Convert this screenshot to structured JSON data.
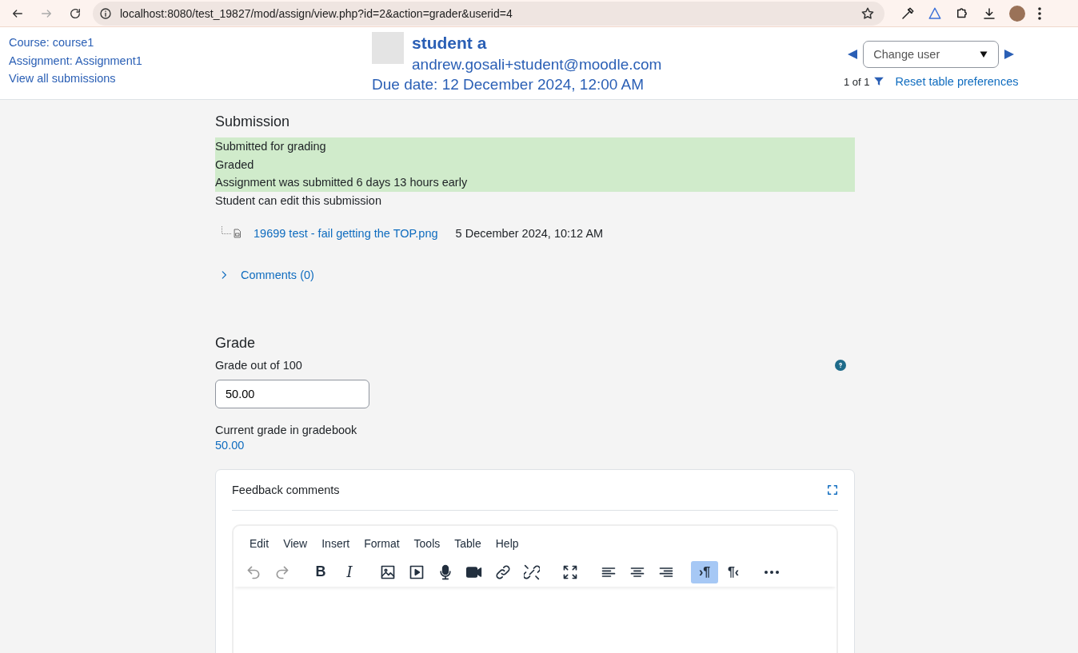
{
  "browser": {
    "url": "localhost:8080/test_19827/mod/assign/view.php?id=2&action=grader&userid=4"
  },
  "header": {
    "links": [
      "Course: course1",
      "Assignment: Assignment1",
      "View all submissions"
    ],
    "user": {
      "name": "student a",
      "email": "andrew.gosali+student@moodle.com",
      "due": "Due date: 12 December 2024, 12:00 AM"
    },
    "change_user": {
      "placeholder": "Change user",
      "count": "1 of 1",
      "reset": "Reset table preferences"
    }
  },
  "submission": {
    "title": "Submission",
    "status": [
      {
        "text": "Submitted for grading",
        "highlight": true
      },
      {
        "text": "Graded",
        "highlight": true
      },
      {
        "text": "Assignment was submitted 6 days 13 hours early",
        "highlight": true
      },
      {
        "text": "Student can edit this submission",
        "highlight": false
      }
    ],
    "file": {
      "name": "19699 test - fail getting the TOP.png",
      "date": "5 December 2024, 10:12 AM"
    },
    "comments": {
      "label": "Comments (0)",
      "expanded": false
    }
  },
  "grade": {
    "title": "Grade",
    "label": "Grade out of 100",
    "value": "50.00",
    "current_label": "Current grade in gradebook",
    "current": "50.00"
  },
  "feedback": {
    "title": "Feedback comments",
    "menu": [
      "Edit",
      "View",
      "Insert",
      "Format",
      "Tools",
      "Table",
      "Help"
    ],
    "toolbar": [
      [
        {
          "kind": "undo",
          "disabled": true,
          "selected": false
        },
        {
          "kind": "redo",
          "disabled": true,
          "selected": false
        }
      ],
      [
        {
          "kind": "bold",
          "label": "B",
          "disabled": false,
          "selected": false
        },
        {
          "kind": "italic",
          "label": "I",
          "disabled": false,
          "selected": false
        }
      ],
      [
        {
          "kind": "image",
          "disabled": false,
          "selected": false
        },
        {
          "kind": "media",
          "disabled": false,
          "selected": false
        },
        {
          "kind": "mic",
          "disabled": false,
          "selected": false
        },
        {
          "kind": "video",
          "disabled": false,
          "selected": false
        },
        {
          "kind": "link",
          "disabled": false,
          "selected": false
        },
        {
          "kind": "unlink",
          "disabled": false,
          "selected": false
        }
      ],
      [
        {
          "kind": "fullscreen",
          "disabled": false,
          "selected": false
        }
      ],
      [
        {
          "kind": "alignleft",
          "disabled": false,
          "selected": false
        },
        {
          "kind": "aligncenter",
          "disabled": false,
          "selected": false
        },
        {
          "kind": "alignright",
          "disabled": false,
          "selected": false
        }
      ],
      [
        {
          "kind": "ltr",
          "label": "›¶",
          "disabled": false,
          "selected": true
        },
        {
          "kind": "rtl",
          "label": "¶‹",
          "disabled": false,
          "selected": false
        }
      ],
      [
        {
          "kind": "more",
          "disabled": false,
          "selected": false
        }
      ]
    ]
  }
}
